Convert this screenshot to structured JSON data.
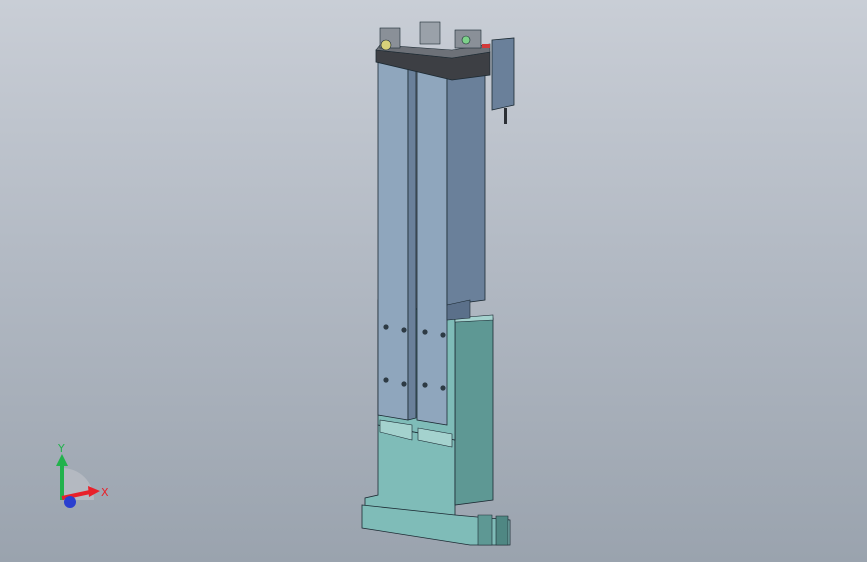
{
  "viewport": {
    "background_top": "#c9ced6",
    "background_bottom": "#9aa3ae"
  },
  "model": {
    "colors": {
      "rail_face": "#8fa6bd",
      "rail_side": "#6a809a",
      "rail_dark": "#5b708a",
      "base_face": "#7fbcb8",
      "base_side": "#5e9894",
      "base_top": "#a4d2ce",
      "cap_dark": "#3d3f44",
      "edge": "#1c2a33"
    }
  },
  "triad": {
    "x_label": "X",
    "y_label": "Y",
    "x_color": "#e8202a",
    "y_color": "#22b24c",
    "z_color": "#2a3fd0"
  }
}
